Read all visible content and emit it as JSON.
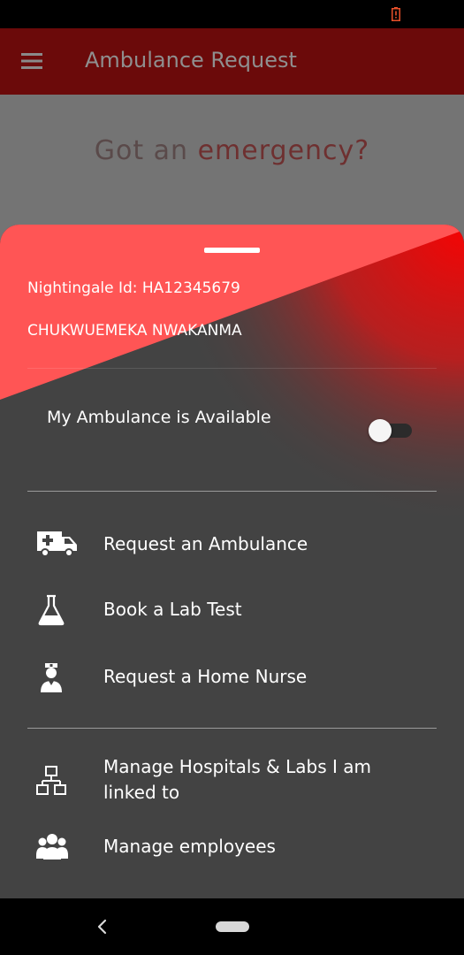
{
  "app_bar": {
    "title": "Ambulance Request"
  },
  "page": {
    "headline_prefix": "Got an ",
    "headline_accent": "emergency?"
  },
  "sheet": {
    "nightingale_id": "Nightingale Id: HA12345679",
    "user_name": "CHUKWUEMEKA NWAKANMA",
    "availability_label": "My Ambulance is Available",
    "availability_on": false,
    "items": [
      {
        "label": "Request an Ambulance",
        "icon": "ambulance-icon"
      },
      {
        "label": "Book a Lab Test",
        "icon": "flask-icon"
      },
      {
        "label": "Request a Home Nurse",
        "icon": "nurse-icon"
      },
      {
        "label": "Manage Hospitals & Labs I am linked to",
        "icon": "network-icon"
      },
      {
        "label": "Manage employees",
        "icon": "group-icon"
      }
    ]
  },
  "colors": {
    "brand_red": "#ff5555",
    "app_bar_dimmed": "#6b0a0a",
    "sheet_dark": "#434343"
  }
}
